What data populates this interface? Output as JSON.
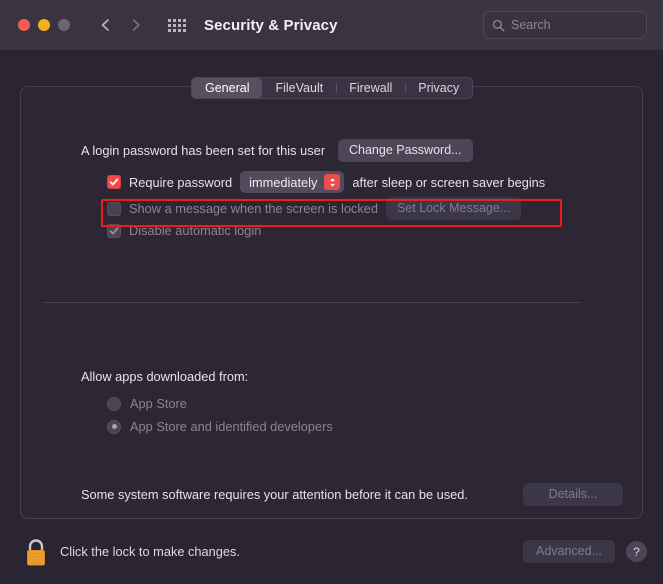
{
  "window": {
    "title": "Security & Privacy",
    "traffic_lights": [
      "close",
      "minimize",
      "zoom"
    ],
    "back_label": "Back",
    "forward_label": "Forward",
    "grid_label": "Show All"
  },
  "search": {
    "placeholder": "Search",
    "value": ""
  },
  "tabs": [
    {
      "label": "General",
      "active": true
    },
    {
      "label": "FileVault",
      "active": false
    },
    {
      "label": "Firewall",
      "active": false
    },
    {
      "label": "Privacy",
      "active": false
    }
  ],
  "general": {
    "password_status": "A login password has been set for this user",
    "change_password_button": "Change Password...",
    "require_password": {
      "checked": true,
      "label_before": "Require password",
      "interval_value": "immediately",
      "label_after": "after sleep or screen saver begins"
    },
    "show_message": {
      "checked": false,
      "label": "Show a message when the screen is locked",
      "button": "Set Lock Message...",
      "disabled": true
    },
    "disable_auto_login": {
      "checked": true,
      "label": "Disable automatic login",
      "disabled": true
    }
  },
  "gatekeeper": {
    "heading": "Allow apps downloaded from:",
    "options": [
      {
        "label": "App Store",
        "selected": false
      },
      {
        "label": "App Store and identified developers",
        "selected": true
      }
    ],
    "notice": "Some system software requires your attention before it can be used.",
    "details_button": "Details..."
  },
  "footer": {
    "lock_text": "Click the lock to make changes.",
    "advanced_button": "Advanced...",
    "help_button": "?"
  },
  "colors": {
    "accent_red": "#ef4b4b",
    "annotation_red": "#ee1c1c",
    "window_bg": "#2b2433",
    "titlebar_bg": "#3a3442",
    "panel_bg": "#2d2735",
    "lock_body": "#f0a030"
  }
}
